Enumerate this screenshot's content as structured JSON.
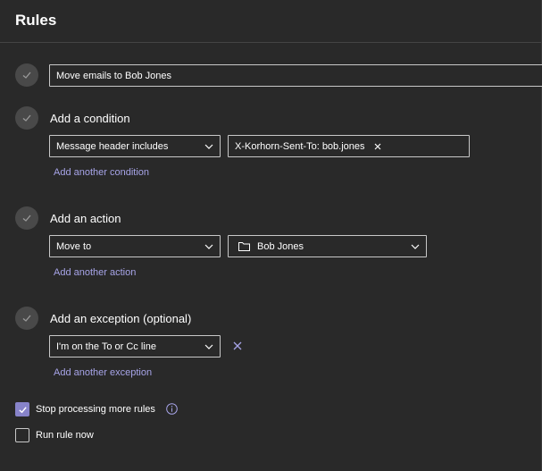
{
  "header": {
    "title": "Rules"
  },
  "rule_name": {
    "value": "Move emails to Bob Jones"
  },
  "condition": {
    "title": "Add a condition",
    "type_value": "Message header includes",
    "tag_value": "X-Korhorn-Sent-To: bob.jones",
    "add_link": "Add another condition"
  },
  "action": {
    "title": "Add an action",
    "type_value": "Move to",
    "folder_value": "Bob Jones",
    "add_link": "Add another action"
  },
  "exception": {
    "title": "Add an exception (optional)",
    "type_value": "I'm on the To or Cc line",
    "add_link": "Add another exception"
  },
  "options": {
    "stop_processing_label": "Stop processing more rules",
    "stop_processing_checked": true,
    "run_now_label": "Run rule now",
    "run_now_checked": false
  },
  "colors": {
    "accent": "#8783c9",
    "link": "#a7a4e8",
    "background": "#292929"
  },
  "icons": [
    "check-icon",
    "chevron-down-icon",
    "close-icon",
    "folder-icon",
    "info-icon"
  ]
}
